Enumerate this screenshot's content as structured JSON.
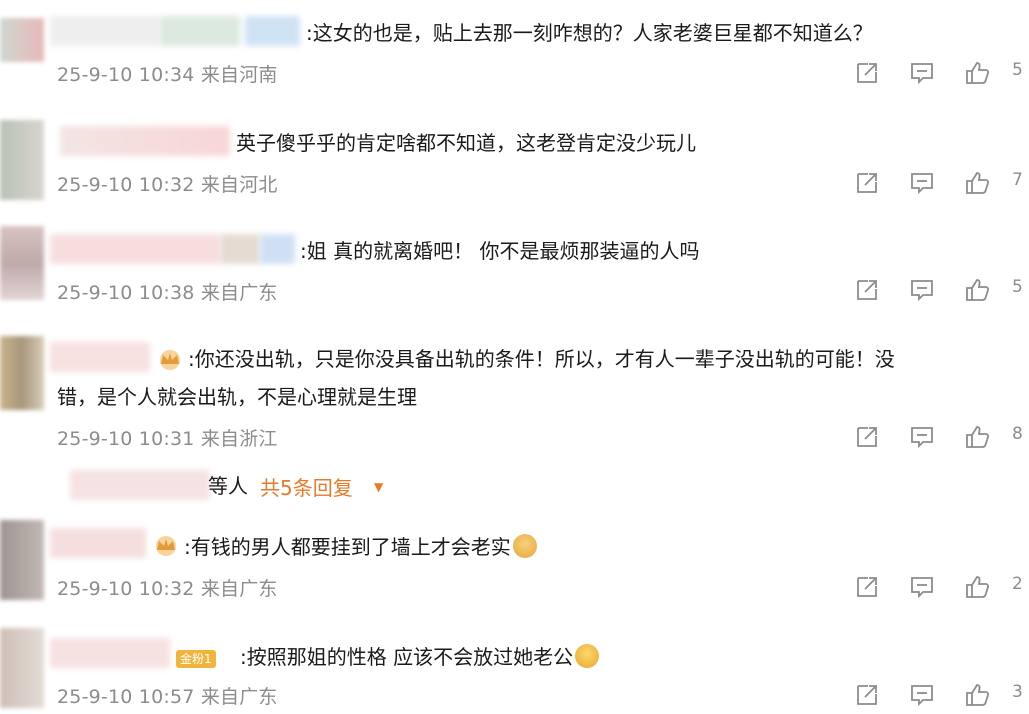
{
  "comments": [
    {
      "name_tail": "",
      "text": ":这女的也是，贴上去那一刻咋想的？人家老婆巨星都不知道么？",
      "time": "25-9-10 10:34",
      "location": "来自河南",
      "likes": "5"
    },
    {
      "name_tail": "",
      "text": "英子傻乎乎的肯定啥都不知道，这老登肯定没少玩儿",
      "time": "25-9-10 10:32",
      "location": "来自河北",
      "likes": "7"
    },
    {
      "name_tail": "",
      "text": ":姐 真的就离婚吧！ 你不是最烦那装逼的人吗",
      "time": "25-9-10 10:38",
      "location": "来自广东",
      "likes": "5"
    },
    {
      "name_tail": "",
      "text_line1": ":你还没出轨，只是你没具备出轨的条件！所以，才有人一辈子没出轨的可能！没",
      "text_line2": "错，是个人就会出轨，不是心理就是生理",
      "time": "25-9-10 10:31",
      "location": "来自浙江",
      "likes": "8",
      "replies": {
        "name_tail": "等人",
        "link": "共5条回复",
        "arrow": "▼"
      }
    },
    {
      "name_tail": "",
      "text": ":有钱的男人都要挂到了墙上才会老实",
      "time": "25-9-10 10:32",
      "location": "来自广东",
      "likes": "2"
    },
    {
      "name_tail": "",
      "badge": "金粉1",
      "text": ":按照那姐的性格 应该不会放过她老公",
      "time": "25-9-10 10:57",
      "location": "来自广东",
      "likes": "3"
    }
  ],
  "icons": {
    "share": "share-icon",
    "comment": "comment-icon",
    "like": "thumbs-up-icon"
  },
  "colors": {
    "meta": "#8c8c8c",
    "reply_link": "#e87a2a",
    "badge": "#f0b43c"
  }
}
